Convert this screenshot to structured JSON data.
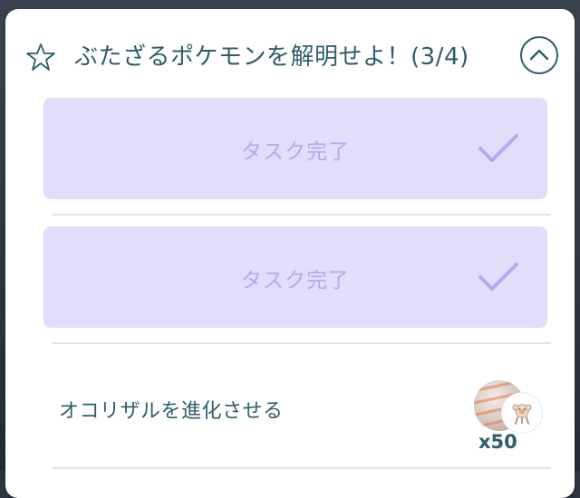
{
  "quest": {
    "title": "ぶたざるポケモンを解明せよ！(3/4)",
    "star_icon": "star-outline-icon",
    "collapse_icon": "chevron-up-icon"
  },
  "tasks": [
    {
      "label": "タスク完了",
      "status": "completed",
      "icon": "checkmark-icon"
    },
    {
      "label": "タスク完了",
      "status": "completed",
      "icon": "checkmark-icon"
    },
    {
      "label": "オコリザルを進化させる",
      "status": "pending",
      "reward": {
        "icon": "candy-icon",
        "pokemon_icon": "mankey-icon",
        "amount": "x50"
      }
    }
  ],
  "colors": {
    "accent": "#2f5d6b",
    "completed_bg": "#e3dcfb",
    "completed_text": "#b6a8ee"
  }
}
